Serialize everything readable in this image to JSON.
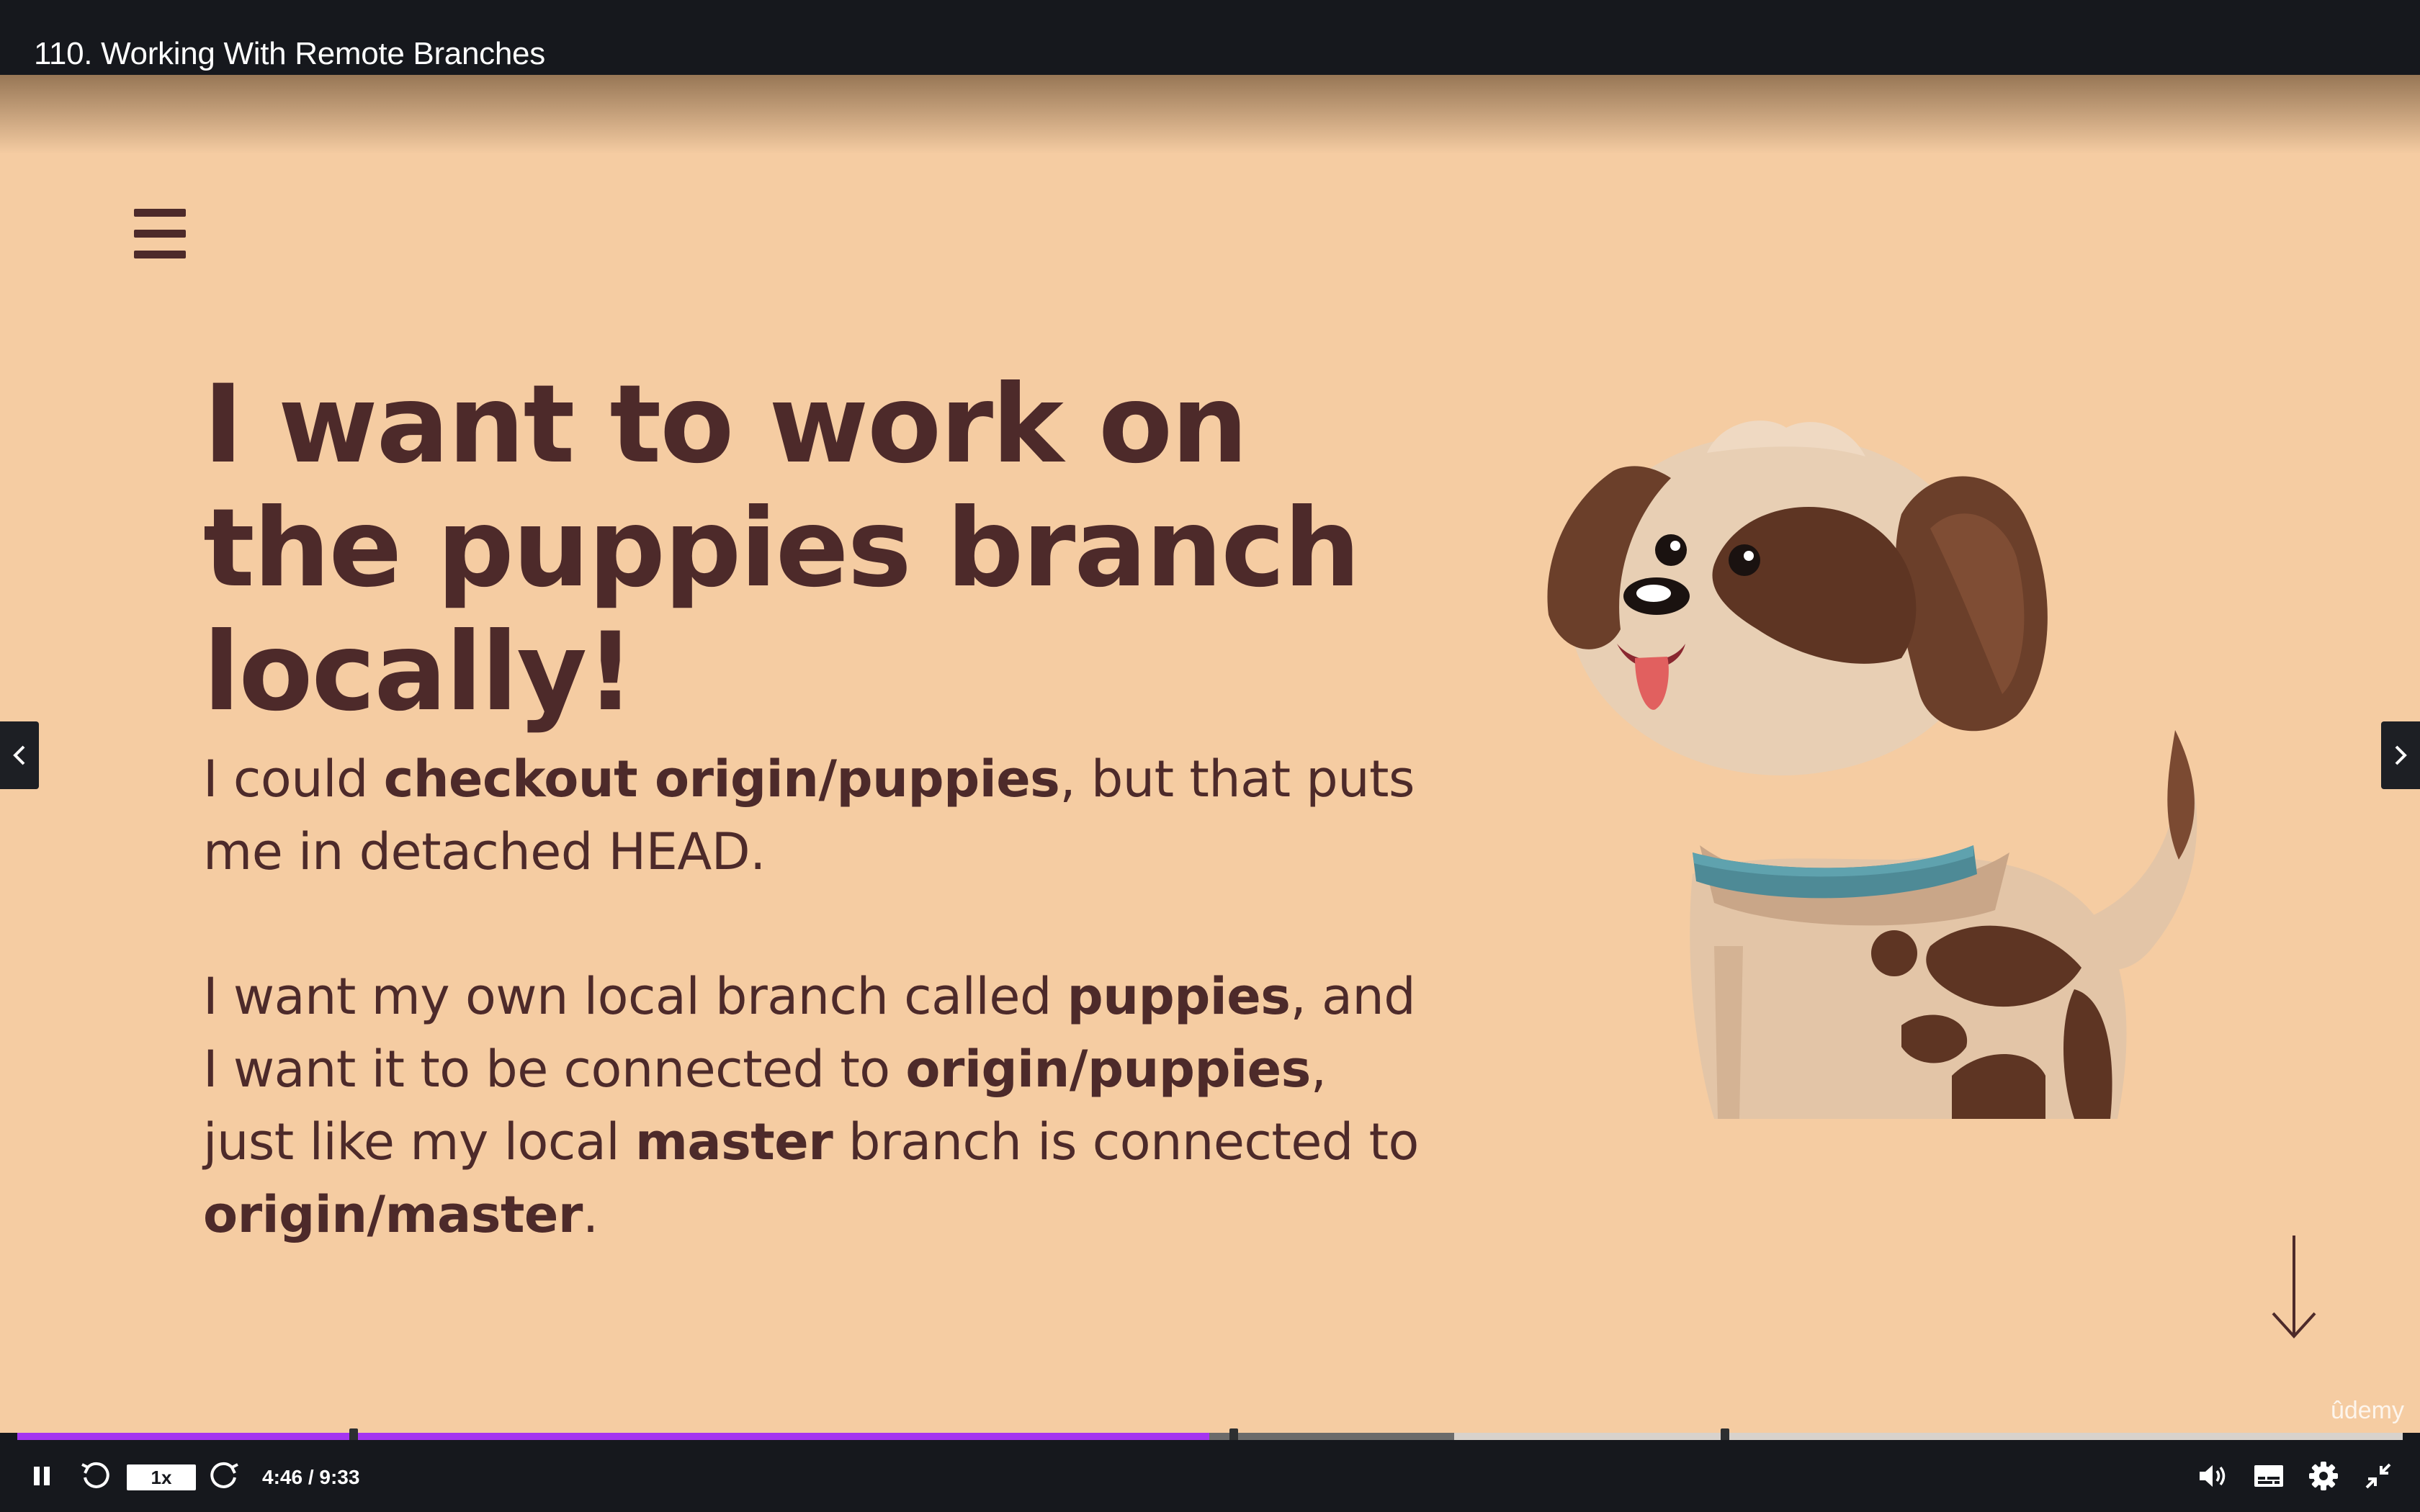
{
  "window": {
    "title": "110. Working With Remote Branches"
  },
  "slide": {
    "headline": "I want to work on the puppies branch locally!",
    "paragraph1": {
      "t1": "I could ",
      "b1": "checkout origin/puppies",
      "t2": ", but that puts me in detached HEAD."
    },
    "paragraph2": {
      "t1": "I want my own local branch called ",
      "b1": "puppies",
      "t2": ", and I want it to be connected to ",
      "b2": "origin/puppies",
      "t3": ", just like my local ",
      "b3": "master",
      "t4": " branch is connected to ",
      "b4": "origin/master",
      "t5": "."
    },
    "background_color": "#f5cca2",
    "text_color": "#4d2a2a",
    "illustration": "puppy-illustration",
    "watermark": "ûdemy"
  },
  "player": {
    "speed_label": "1x",
    "time_display": "4:46 / 9:33",
    "progress_fraction": 0.4996,
    "buffered_fraction": 0.6023,
    "chapter_marker_fractions": [
      0.141,
      0.51,
      0.716
    ],
    "accent_color": "#a435f0",
    "icons": [
      "pause-icon",
      "rewind-icon",
      "forward-icon",
      "volume-icon",
      "captions-icon",
      "settings-icon",
      "exit-fullscreen-icon"
    ]
  }
}
